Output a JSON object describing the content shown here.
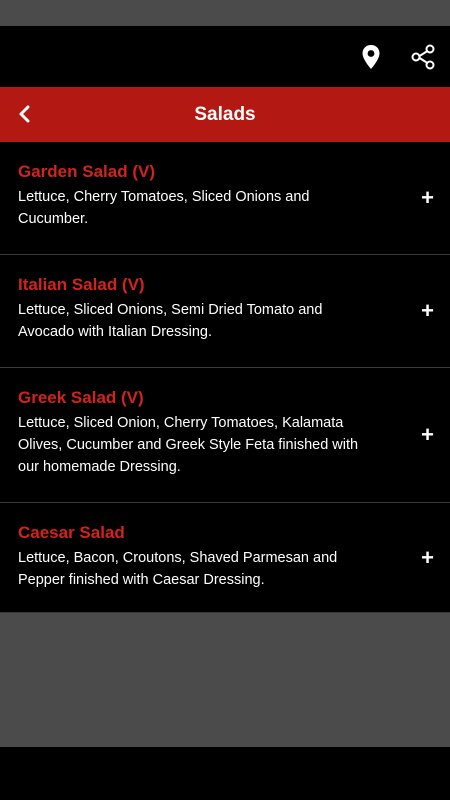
{
  "header": {
    "location_icon": "location-pin-icon",
    "share_icon": "share-icon"
  },
  "title_bar": {
    "back_icon": "chevron-left-icon",
    "title": "Salads"
  },
  "items": [
    {
      "name": "Garden Salad (V)",
      "description": "Lettuce, Cherry Tomatoes, Sliced Onions and Cucumber.",
      "action": "+"
    },
    {
      "name": "Italian Salad (V)",
      "description": "Lettuce, Sliced Onions, Semi Dried Tomato and Avocado with Italian Dressing.",
      "action": "+"
    },
    {
      "name": "Greek Salad (V)",
      "description": "Lettuce, Sliced Onion, Cherry Tomatoes, Kalamata Olives, Cucumber and Greek Style Feta finished with our homemade Dressing.",
      "action": "+"
    },
    {
      "name": "Caesar Salad",
      "description": "Lettuce, Bacon, Croutons, Shaved Parmesan and Pepper finished with Caesar Dressing.",
      "action": "+"
    }
  ],
  "colors": {
    "accent": "#b31812",
    "item_title": "#d2231c",
    "background": "#000000",
    "gray": "#4b4b4b"
  }
}
